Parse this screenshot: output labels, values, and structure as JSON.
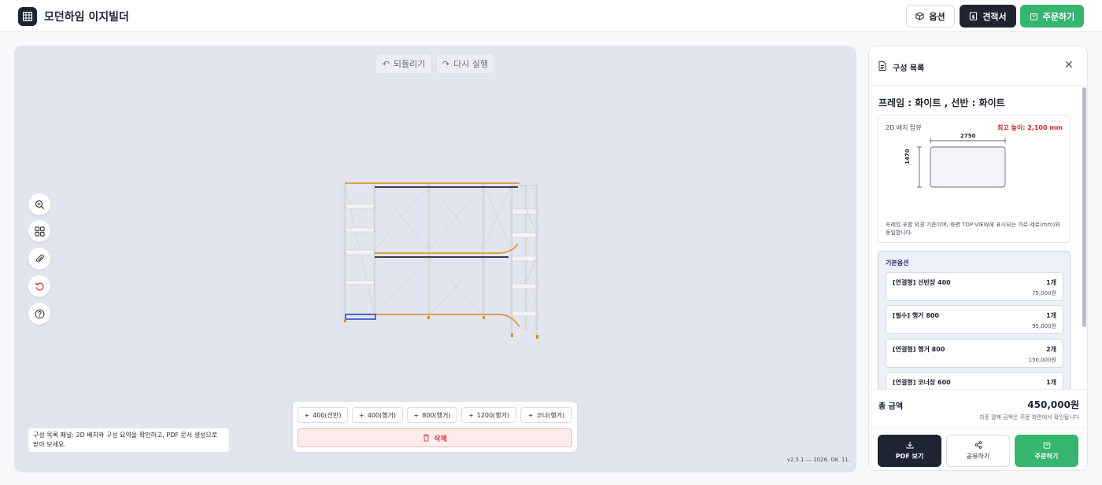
{
  "header": {
    "title": "모던하임 이지빌더",
    "options_label": "옵션",
    "quote_label": "견적서",
    "order_label": "주문하기"
  },
  "canvas": {
    "undo_label": "되돌리기",
    "redo_label": "다시 실행",
    "tools": [
      "zoom-in-icon",
      "grid-icon",
      "attach-icon",
      "reset-icon",
      "help-icon"
    ],
    "hint": "구성 목록 패널: 2D 배치와 구성 요약을 확인하고, PDF 문서 생성으로 받아 보세요.",
    "version": "v2.5.1 — 2026. 08. 11.",
    "add_buttons": [
      {
        "label": "400(선반)"
      },
      {
        "label": "400(행거)"
      },
      {
        "label": "800(행거)"
      },
      {
        "label": "1200(행거)"
      },
      {
        "label": "코너(행거)"
      }
    ],
    "delete_label": "삭제"
  },
  "panel": {
    "title": "구성 목록",
    "frame_title": "프레임 : 화이트 , 선반 : 화이트",
    "top_view": {
      "label": "2D 배치 탑뷰",
      "max_height": "최고 높이: 2,100 mm",
      "width_dim": "2750",
      "depth_dim": "1470",
      "note": "프레임 포함 외경 기준이며, 화면 TOP VIEW에 표시되는 가로·세로(mm)와 동일합니다."
    },
    "options": {
      "title": "기본옵션",
      "items": [
        {
          "name": "[연결형] 선반장 400",
          "qty": "1개",
          "price": "75,000원"
        },
        {
          "name": "[필수] 행거 800",
          "qty": "1개",
          "price": "95,000원"
        },
        {
          "name": "[연결형] 행거 800",
          "qty": "2개",
          "price": "150,000원"
        },
        {
          "name": "[연결형] 코너장 600",
          "qty": "1개",
          "price": ""
        }
      ]
    },
    "total": {
      "label": "총 금액",
      "value": "450,000원",
      "note": "최종 결제 금액은 주문 화면에서 확인됩니다"
    },
    "buttons": {
      "pdf": "PDF 보기",
      "share": "공유하기",
      "order": "주문하기"
    }
  },
  "colors": {
    "brand_dark": "#1f2433",
    "order_green": "#35b56d",
    "danger_red": "#d13a3a",
    "canvas_bg": "#e2e5ef"
  }
}
